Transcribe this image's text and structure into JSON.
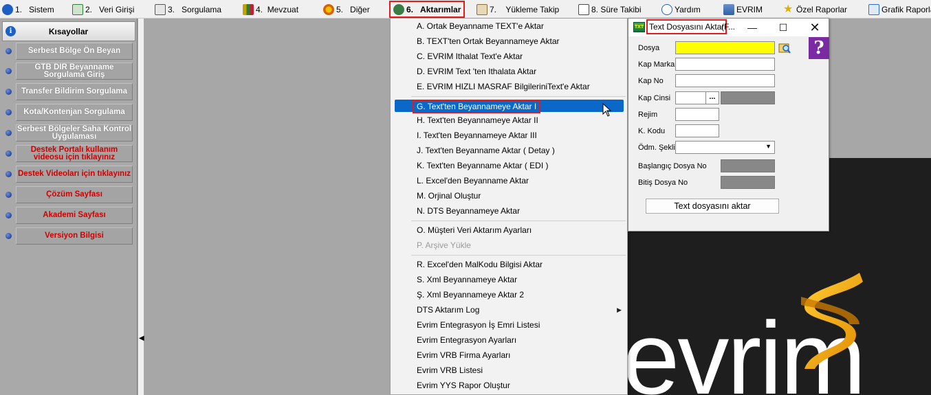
{
  "menubar": {
    "items": [
      {
        "num": "1.",
        "label": "Sistem",
        "color": "#1d5fc4"
      },
      {
        "num": "2.",
        "label": "Veri Girişi",
        "color": "#2f7d32"
      },
      {
        "num": "3.",
        "label": "Sorgulama",
        "color": "#555555"
      },
      {
        "num": "4.",
        "label": "Mevzuat",
        "color": "#c8a000"
      },
      {
        "num": "5.",
        "label": "Diğer",
        "color": "#d95f02"
      },
      {
        "num": "6.",
        "label": "Aktarımlar",
        "color": "#3a7d44"
      },
      {
        "num": "7.",
        "label": "Yükleme Takip",
        "color": "#8a6d3b"
      },
      {
        "num": "8.",
        "label": "Süre Takibi",
        "color": "#4a4a4a"
      },
      {
        "num": "",
        "label": "Yardım",
        "color": "#1d5fc4"
      },
      {
        "num": "",
        "label": "EVRIM",
        "color": "#3060a0"
      },
      {
        "num": "",
        "label": "Özel Raporlar",
        "color": "#e0b000"
      },
      {
        "num": "",
        "label": "Grafik Raporlar",
        "color": "#2f6fbf"
      }
    ]
  },
  "shortcuts": {
    "title": "Kısayollar",
    "items": [
      {
        "label": "Serbest Bölge Ön Beyan",
        "red": false
      },
      {
        "label": "GTB DIR Beyanname Sorgulama Giriş",
        "red": false
      },
      {
        "label": "Transfer Bildirim Sorgulama",
        "red": false
      },
      {
        "label": "Kota/Kontenjan Sorgulama",
        "red": false
      },
      {
        "label": "Serbest Bölgeler Saha Kontrol Uygulaması",
        "red": false
      },
      {
        "label": "Destek Portalı kullanım videosu için tıklayınız",
        "red": true
      },
      {
        "label": "Destek Videoları için tıklayınız",
        "red": true
      },
      {
        "label": "Çözüm Sayfası",
        "red": true
      },
      {
        "label": "Akademi Sayfası",
        "red": true
      },
      {
        "label": "Versiyon Bilgisi",
        "red": true
      }
    ]
  },
  "dropdown": {
    "items": [
      {
        "label": "A.   Ortak Beyanname TEXT'e Aktar"
      },
      {
        "label": "B.   TEXT'ten Ortak Beyannameye Aktar"
      },
      {
        "label": "C.   EVRIM Ithalat Text'e Aktar"
      },
      {
        "label": "D.   EVRIM Text 'ten Ithalata Aktar"
      },
      {
        "label": "E.    EVRIM  HIZLI MASRAF BilgileriniText'e Aktar"
      },
      {
        "label": "G.  Text'ten Beyannameye Aktar I"
      },
      {
        "label": "H.  Text'ten Beyannameye Aktar II"
      },
      {
        "label": "I.  Text'ten Beyannameye Aktar III"
      },
      {
        "label": "J.   Text'ten Beyanname Aktar ( Detay )"
      },
      {
        "label": "K.   Text'ten Beyanname Aktar ( EDI )"
      },
      {
        "label": "L.   Excel'den Beyanname Aktar"
      },
      {
        "label": "M.    Orjinal Oluştur"
      },
      {
        "label": "N.   DTS Beyannameye Aktar"
      },
      {
        "label": "O.  Müşteri Veri Aktarım Ayarları"
      },
      {
        "label": "P.  Arşive Yükle"
      },
      {
        "label": "R.   Excel'den MalKodu Bilgisi Aktar"
      },
      {
        "label": "S.  Xml Beyannameye Aktar"
      },
      {
        "label": "Ş.  Xml Beyannameye Aktar 2"
      },
      {
        "label": "DTS Aktarım Log"
      },
      {
        "label": "Evrim Entegrasyon İş Emri Listesi"
      },
      {
        "label": "Evrim Entegrasyon Ayarları"
      },
      {
        "label": "Evrim VRB Firma Ayarları"
      },
      {
        "label": "Evrim VRB Listesi"
      },
      {
        "label": "Evrim YYS Rapor Oluştur"
      }
    ]
  },
  "window": {
    "title": "Text Dosyasını Aktar",
    "title_rest": "(F...",
    "labels": {
      "dosya": "Dosya",
      "kap_marka": "Kap Marka",
      "kap_no": "Kap No",
      "kap_cinsi": "Kap Cinsi",
      "rejim": "Rejim",
      "k_kodu": "K. Kodu",
      "odm_sekli": "Ödm. Şekli",
      "baslangic": "Başlangıç  Dosya No",
      "bitis": "Bitiş  Dosya No"
    },
    "button_label": "Text dosyasını aktar",
    "dots_label": "...",
    "help_label": "?"
  },
  "logo": {
    "text": "evrim"
  }
}
